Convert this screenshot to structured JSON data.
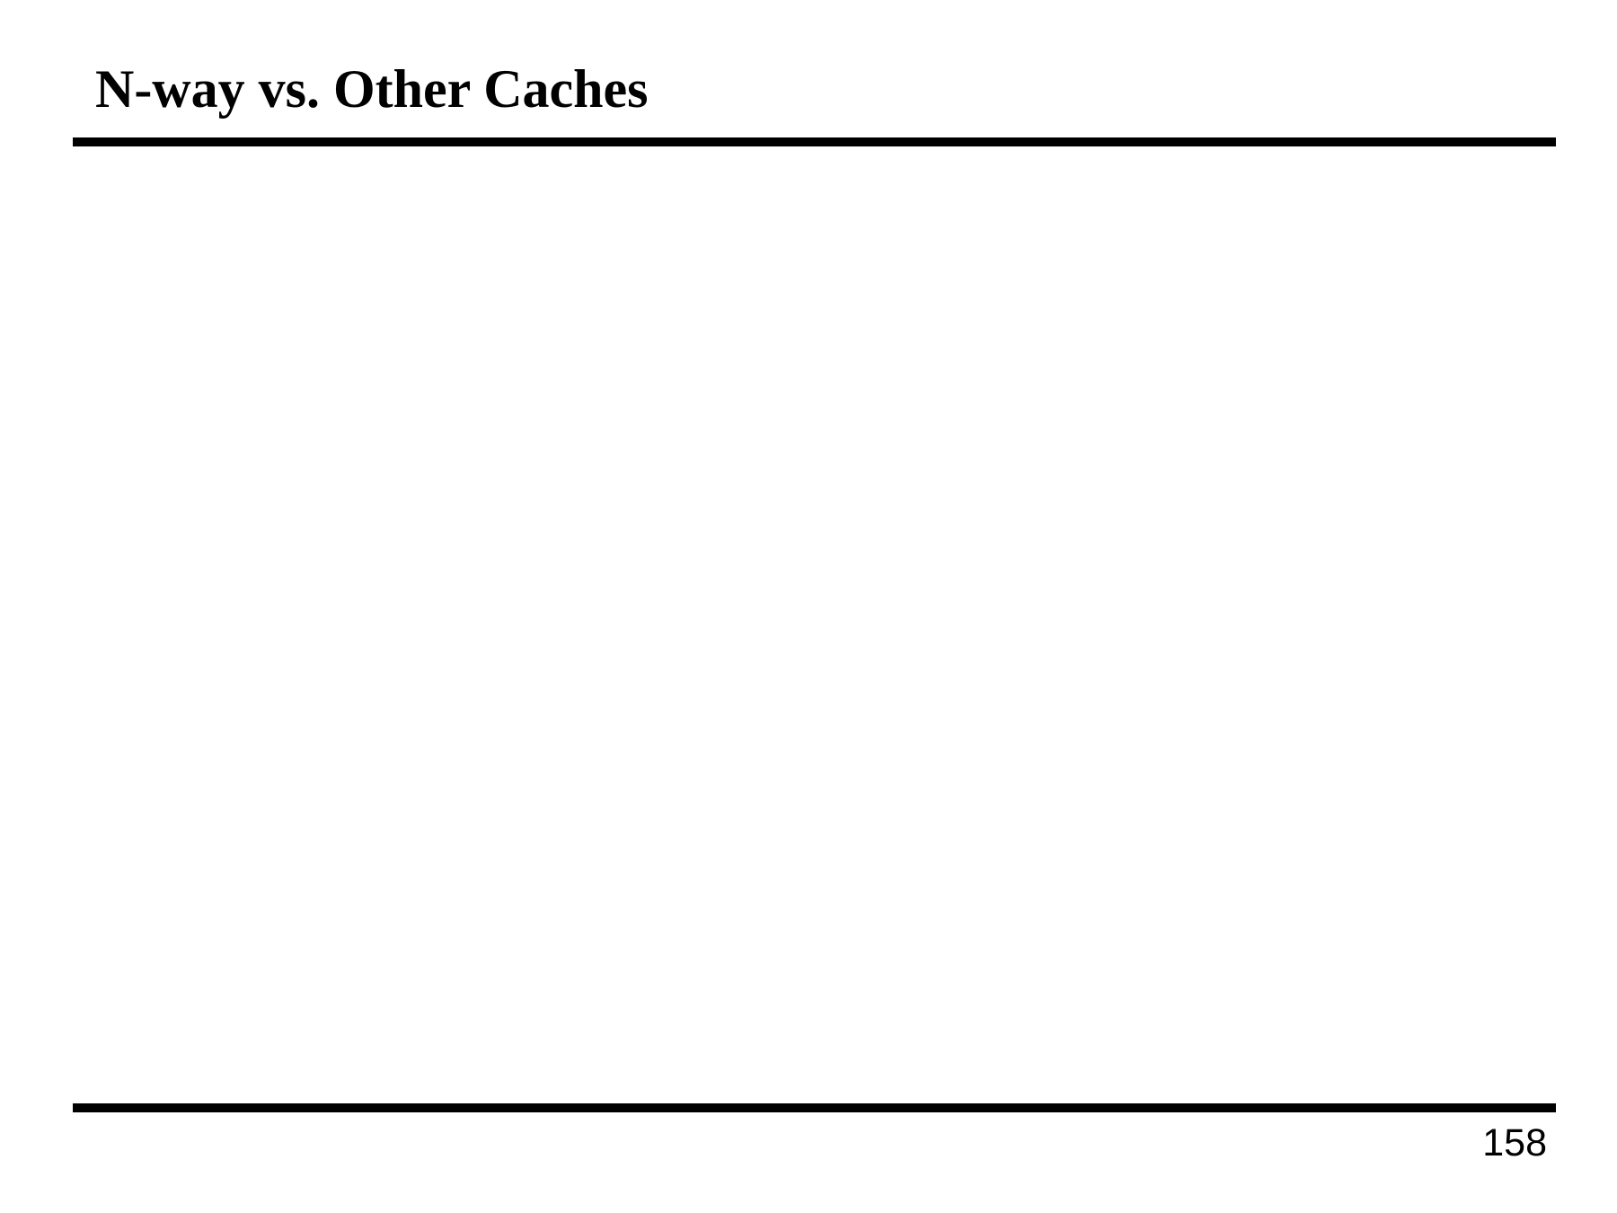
{
  "slide": {
    "title": "N-way vs. Other Caches",
    "page_number": "158"
  }
}
